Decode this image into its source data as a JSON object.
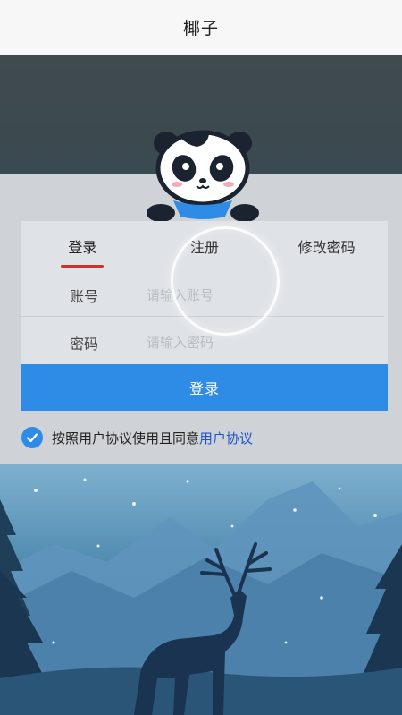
{
  "header": {
    "title": "椰子"
  },
  "tabs": [
    {
      "label": "登录",
      "active": true
    },
    {
      "label": "注册",
      "active": false
    },
    {
      "label": "修改密码",
      "active": false
    }
  ],
  "form": {
    "account": {
      "label": "账号",
      "placeholder": "请输入账号",
      "value": ""
    },
    "password": {
      "label": "密码",
      "placeholder": "请输入密码",
      "value": ""
    },
    "submit_label": "登录"
  },
  "agreement": {
    "checked": true,
    "text": "按照用户协议使用且同意",
    "link": "用户协议"
  },
  "colors": {
    "accent": "#2e8be6",
    "tab_indicator": "#d32f2f",
    "link": "#1f54c9"
  },
  "icons": [
    "panda-mascot-icon",
    "checkmark-icon",
    "deer-silhouette-icon"
  ]
}
